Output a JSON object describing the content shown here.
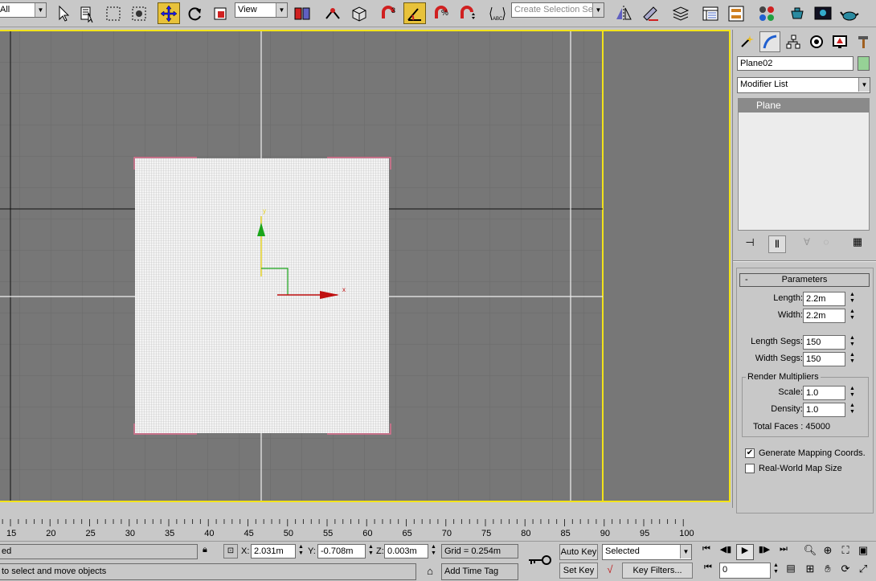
{
  "toolbar": {
    "selection_filter": "All",
    "ref_coord": "View",
    "named_selection_placeholder": "Create Selection Set",
    "snap_angle_label": "3"
  },
  "viewport": {
    "gizmo_x": "x",
    "gizmo_y": "y",
    "accent": "#f2e31a"
  },
  "command_panel": {
    "object_name": "Plane02",
    "object_color": "#96d296",
    "modifier_list": "Modifier List",
    "stack_items": [
      "Plane"
    ],
    "rollout_title": "Parameters",
    "params": {
      "length_label": "Length:",
      "length": "2.2m",
      "width_label": "Width:",
      "width": "2.2m",
      "length_segs_label": "Length Segs:",
      "length_segs": "150",
      "width_segs_label": "Width Segs:",
      "width_segs": "150",
      "render_mult_label": "Render Multipliers",
      "scale_label": "Scale:",
      "scale": "1.0",
      "density_label": "Density:",
      "density": "1.0",
      "total_faces": "Total Faces : 45000",
      "gen_mapping_label": "Generate Mapping Coords.",
      "gen_mapping_checked": true,
      "real_world_label": "Real-World Map Size",
      "real_world_checked": false
    }
  },
  "timeline": {
    "ticks": [
      "15",
      "20",
      "25",
      "30",
      "35",
      "40",
      "45",
      "50",
      "55",
      "60",
      "65",
      "70",
      "75",
      "80",
      "85",
      "90",
      "95",
      "100"
    ]
  },
  "status": {
    "selection_text": "ed",
    "prompt": "to select and move objects",
    "x_label": "X:",
    "x": "2.031m",
    "y_label": "Y:",
    "y": "-0.708m",
    "z_label": "Z:",
    "z": "0.003m",
    "grid": "Grid = 0.254m",
    "add_time_tag": "Add Time Tag",
    "auto_key": "Auto Key",
    "set_key": "Set Key",
    "key_mode": "Selected",
    "key_filters": "Key Filters...",
    "frame": "0"
  }
}
